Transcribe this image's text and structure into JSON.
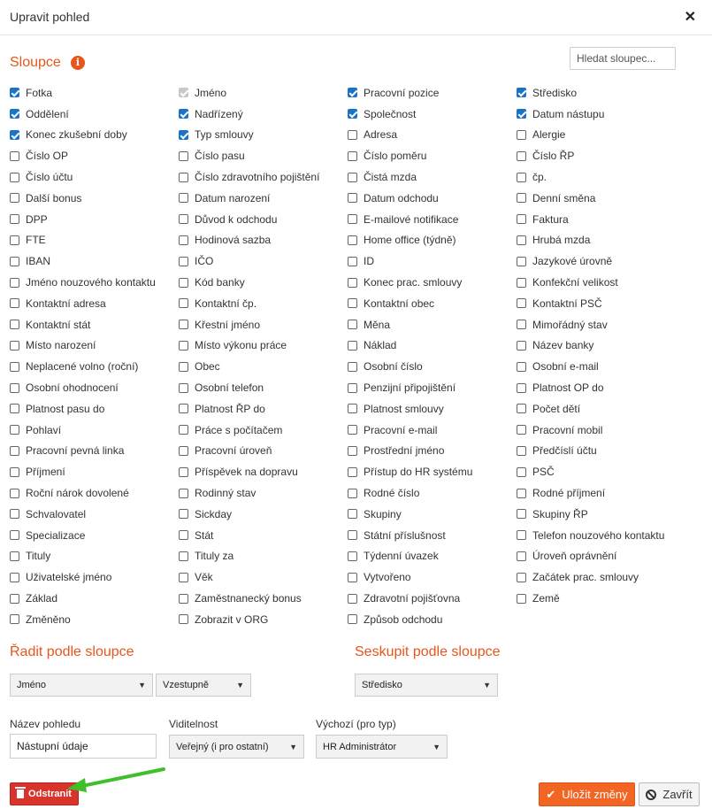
{
  "dialog": {
    "title": "Upravit pohled",
    "close_glyph": "✕"
  },
  "columns_section": {
    "title": "Sloupce",
    "info_glyph": "i",
    "search_placeholder": "Hledat sloupec..."
  },
  "columns": [
    {
      "label": "Fotka",
      "state": "checked"
    },
    {
      "label": "Jméno",
      "state": "disabled"
    },
    {
      "label": "Pracovní pozice",
      "state": "checked"
    },
    {
      "label": "Středisko",
      "state": "checked"
    },
    {
      "label": "Oddělení",
      "state": "checked"
    },
    {
      "label": "Nadřízený",
      "state": "checked"
    },
    {
      "label": "Společnost",
      "state": "checked"
    },
    {
      "label": "Datum nástupu",
      "state": "checked"
    },
    {
      "label": "Konec zkušební doby",
      "state": "checked"
    },
    {
      "label": "Typ smlouvy",
      "state": "checked"
    },
    {
      "label": "Adresa",
      "state": "unchecked"
    },
    {
      "label": "Alergie",
      "state": "unchecked"
    },
    {
      "label": "Číslo OP",
      "state": "unchecked"
    },
    {
      "label": "Číslo pasu",
      "state": "unchecked"
    },
    {
      "label": "Číslo poměru",
      "state": "unchecked"
    },
    {
      "label": "Číslo ŘP",
      "state": "unchecked"
    },
    {
      "label": "Číslo účtu",
      "state": "unchecked"
    },
    {
      "label": "Číslo zdravotního pojištění",
      "state": "unchecked"
    },
    {
      "label": "Čistá mzda",
      "state": "unchecked"
    },
    {
      "label": "čp.",
      "state": "unchecked"
    },
    {
      "label": "Další bonus",
      "state": "unchecked"
    },
    {
      "label": "Datum narození",
      "state": "unchecked"
    },
    {
      "label": "Datum odchodu",
      "state": "unchecked"
    },
    {
      "label": "Denní směna",
      "state": "unchecked"
    },
    {
      "label": "DPP",
      "state": "unchecked"
    },
    {
      "label": "Důvod k odchodu",
      "state": "unchecked"
    },
    {
      "label": "E-mailové notifikace",
      "state": "unchecked"
    },
    {
      "label": "Faktura",
      "state": "unchecked"
    },
    {
      "label": "FTE",
      "state": "unchecked"
    },
    {
      "label": "Hodinová sazba",
      "state": "unchecked"
    },
    {
      "label": "Home office (týdně)",
      "state": "unchecked"
    },
    {
      "label": "Hrubá mzda",
      "state": "unchecked"
    },
    {
      "label": "IBAN",
      "state": "unchecked"
    },
    {
      "label": "IČO",
      "state": "unchecked"
    },
    {
      "label": "ID",
      "state": "unchecked"
    },
    {
      "label": "Jazykové úrovně",
      "state": "unchecked"
    },
    {
      "label": "Jméno nouzového kontaktu",
      "state": "unchecked"
    },
    {
      "label": "Kód banky",
      "state": "unchecked"
    },
    {
      "label": "Konec prac. smlouvy",
      "state": "unchecked"
    },
    {
      "label": "Konfekční velikost",
      "state": "unchecked"
    },
    {
      "label": "Kontaktní adresa",
      "state": "unchecked"
    },
    {
      "label": "Kontaktní čp.",
      "state": "unchecked"
    },
    {
      "label": "Kontaktní obec",
      "state": "unchecked"
    },
    {
      "label": "Kontaktní PSČ",
      "state": "unchecked"
    },
    {
      "label": "Kontaktní stát",
      "state": "unchecked"
    },
    {
      "label": "Křestní jméno",
      "state": "unchecked"
    },
    {
      "label": "Měna",
      "state": "unchecked"
    },
    {
      "label": "Mimořádný stav",
      "state": "unchecked"
    },
    {
      "label": "Místo narození",
      "state": "unchecked"
    },
    {
      "label": "Místo výkonu práce",
      "state": "unchecked"
    },
    {
      "label": "Náklad",
      "state": "unchecked"
    },
    {
      "label": "Název banky",
      "state": "unchecked"
    },
    {
      "label": "Neplacené volno (roční)",
      "state": "unchecked"
    },
    {
      "label": "Obec",
      "state": "unchecked"
    },
    {
      "label": "Osobní číslo",
      "state": "unchecked"
    },
    {
      "label": "Osobní e-mail",
      "state": "unchecked"
    },
    {
      "label": "Osobní ohodnocení",
      "state": "unchecked"
    },
    {
      "label": "Osobní telefon",
      "state": "unchecked"
    },
    {
      "label": "Penzijní připojištění",
      "state": "unchecked"
    },
    {
      "label": "Platnost OP do",
      "state": "unchecked"
    },
    {
      "label": "Platnost pasu do",
      "state": "unchecked"
    },
    {
      "label": "Platnost ŘP do",
      "state": "unchecked"
    },
    {
      "label": "Platnost smlouvy",
      "state": "unchecked"
    },
    {
      "label": "Počet dětí",
      "state": "unchecked"
    },
    {
      "label": "Pohlaví",
      "state": "unchecked"
    },
    {
      "label": "Práce s počítačem",
      "state": "unchecked"
    },
    {
      "label": "Pracovní e-mail",
      "state": "unchecked"
    },
    {
      "label": "Pracovní mobil",
      "state": "unchecked"
    },
    {
      "label": "Pracovní pevná linka",
      "state": "unchecked"
    },
    {
      "label": "Pracovní úroveň",
      "state": "unchecked"
    },
    {
      "label": "Prostřední jméno",
      "state": "unchecked"
    },
    {
      "label": "Předčíslí účtu",
      "state": "unchecked"
    },
    {
      "label": "Příjmení",
      "state": "unchecked"
    },
    {
      "label": "Příspěvek na dopravu",
      "state": "unchecked"
    },
    {
      "label": "Přístup do HR systému",
      "state": "unchecked"
    },
    {
      "label": "PSČ",
      "state": "unchecked"
    },
    {
      "label": "Roční nárok dovolené",
      "state": "unchecked"
    },
    {
      "label": "Rodinný stav",
      "state": "unchecked"
    },
    {
      "label": "Rodné číslo",
      "state": "unchecked"
    },
    {
      "label": "Rodné příjmení",
      "state": "unchecked"
    },
    {
      "label": "Schvalovatel",
      "state": "unchecked"
    },
    {
      "label": "Sickday",
      "state": "unchecked"
    },
    {
      "label": "Skupiny",
      "state": "unchecked"
    },
    {
      "label": "Skupiny ŘP",
      "state": "unchecked"
    },
    {
      "label": "Specializace",
      "state": "unchecked"
    },
    {
      "label": "Stát",
      "state": "unchecked"
    },
    {
      "label": "Státní příslušnost",
      "state": "unchecked"
    },
    {
      "label": "Telefon nouzového kontaktu",
      "state": "unchecked"
    },
    {
      "label": "Tituly",
      "state": "unchecked"
    },
    {
      "label": "Tituly za",
      "state": "unchecked"
    },
    {
      "label": "Týdenní úvazek",
      "state": "unchecked"
    },
    {
      "label": "Úroveň oprávnění",
      "state": "unchecked"
    },
    {
      "label": "Uživatelské jméno",
      "state": "unchecked"
    },
    {
      "label": "Věk",
      "state": "unchecked"
    },
    {
      "label": "Vytvořeno",
      "state": "unchecked"
    },
    {
      "label": "Začátek prac. smlouvy",
      "state": "unchecked"
    },
    {
      "label": "Základ",
      "state": "unchecked"
    },
    {
      "label": "Zaměstnanecký bonus",
      "state": "unchecked"
    },
    {
      "label": "Zdravotní pojišťovna",
      "state": "unchecked"
    },
    {
      "label": "Země",
      "state": "unchecked"
    },
    {
      "label": "Změněno",
      "state": "unchecked"
    },
    {
      "label": "Zobrazit v ORG",
      "state": "unchecked"
    },
    {
      "label": "Způsob odchodu",
      "state": "unchecked"
    },
    {
      "label": "",
      "state": "none"
    }
  ],
  "sort": {
    "title": "Řadit podle sloupce",
    "column_value": "Jméno",
    "direction_value": "Vzestupně"
  },
  "group": {
    "title": "Seskupit podle sloupce",
    "value": "Středisko"
  },
  "view_name": {
    "label": "Název pohledu",
    "value": "Nástupní údaje"
  },
  "visibility": {
    "label": "Viditelnost",
    "value": "Veřejný (i pro ostatní)"
  },
  "default_for": {
    "label": "Výchozí (pro typ)",
    "value": "HR Administrátor"
  },
  "buttons": {
    "delete": "Odstranit",
    "save": "Uložit změny",
    "close": "Zavřít"
  },
  "colors": {
    "accent": "#e8561c",
    "checkbox": "#1a73c6",
    "danger": "#d9342b",
    "save": "#f26522",
    "annotation_arrow": "#3fbf2a"
  }
}
